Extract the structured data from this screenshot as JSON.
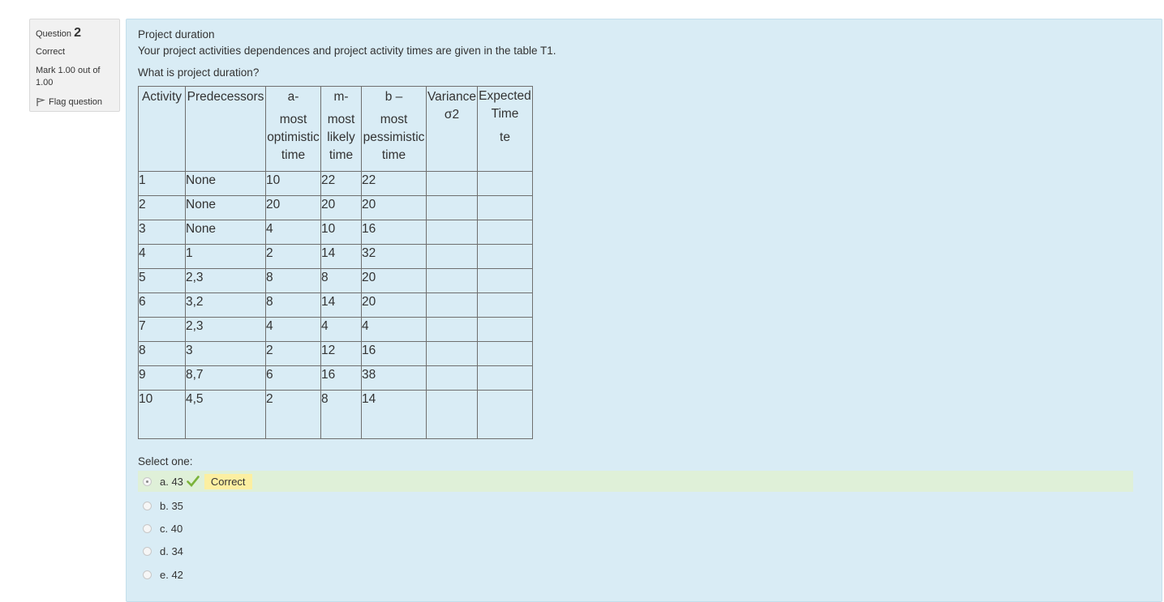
{
  "info": {
    "question_label": "Question",
    "question_number": "2",
    "state": "Correct",
    "grade": "Mark 1.00 out of 1.00",
    "flag_label": "Flag question"
  },
  "question": {
    "title": "Project duration",
    "description": "Your project activities dependences and project activity times are given in the table T1.",
    "ask": "What is project duration?"
  },
  "table": {
    "headers": [
      [
        "Activity"
      ],
      [
        "Predecessors"
      ],
      [
        "a-",
        "most",
        "optimistic",
        "time"
      ],
      [
        "m-",
        "most",
        "likely",
        "time"
      ],
      [
        "b –",
        "most",
        "pessimistic",
        "time"
      ],
      [
        "Variance",
        "σ2"
      ],
      [
        "Expected",
        "Time",
        "te"
      ]
    ],
    "rows": [
      [
        "1",
        "None",
        "10",
        "22",
        "22",
        "",
        ""
      ],
      [
        "2",
        "None",
        "20",
        "20",
        "20",
        "",
        ""
      ],
      [
        "3",
        "None",
        "4",
        "10",
        "16",
        "",
        ""
      ],
      [
        "4",
        "1",
        "2",
        "14",
        "32",
        "",
        ""
      ],
      [
        "5",
        "2,3",
        "8",
        "8",
        "20",
        "",
        ""
      ],
      [
        "6",
        "3,2",
        "8",
        "14",
        "20",
        "",
        ""
      ],
      [
        "7",
        "2,3",
        "4",
        "4",
        "4",
        "",
        ""
      ],
      [
        "8",
        "3",
        "2",
        "12",
        "16",
        "",
        ""
      ],
      [
        "9",
        "8,7",
        "6",
        "16",
        "38",
        "",
        ""
      ],
      [
        "10",
        "4,5",
        "2",
        "8",
        "14",
        "",
        ""
      ]
    ]
  },
  "answers": {
    "prompt": "Select one:",
    "options": [
      {
        "label": "a. 43",
        "selected": true,
        "correct": true
      },
      {
        "label": "b. 35",
        "selected": false
      },
      {
        "label": "c. 40",
        "selected": false
      },
      {
        "label": "d. 34",
        "selected": false
      },
      {
        "label": "e. 42",
        "selected": false
      }
    ],
    "feedback": "Correct"
  },
  "colors": {
    "content_bg": "#d9ecf5",
    "correct_bg": "#dff0d8",
    "feedback_bg": "#fcefa1",
    "tick": "#7bb33a"
  }
}
